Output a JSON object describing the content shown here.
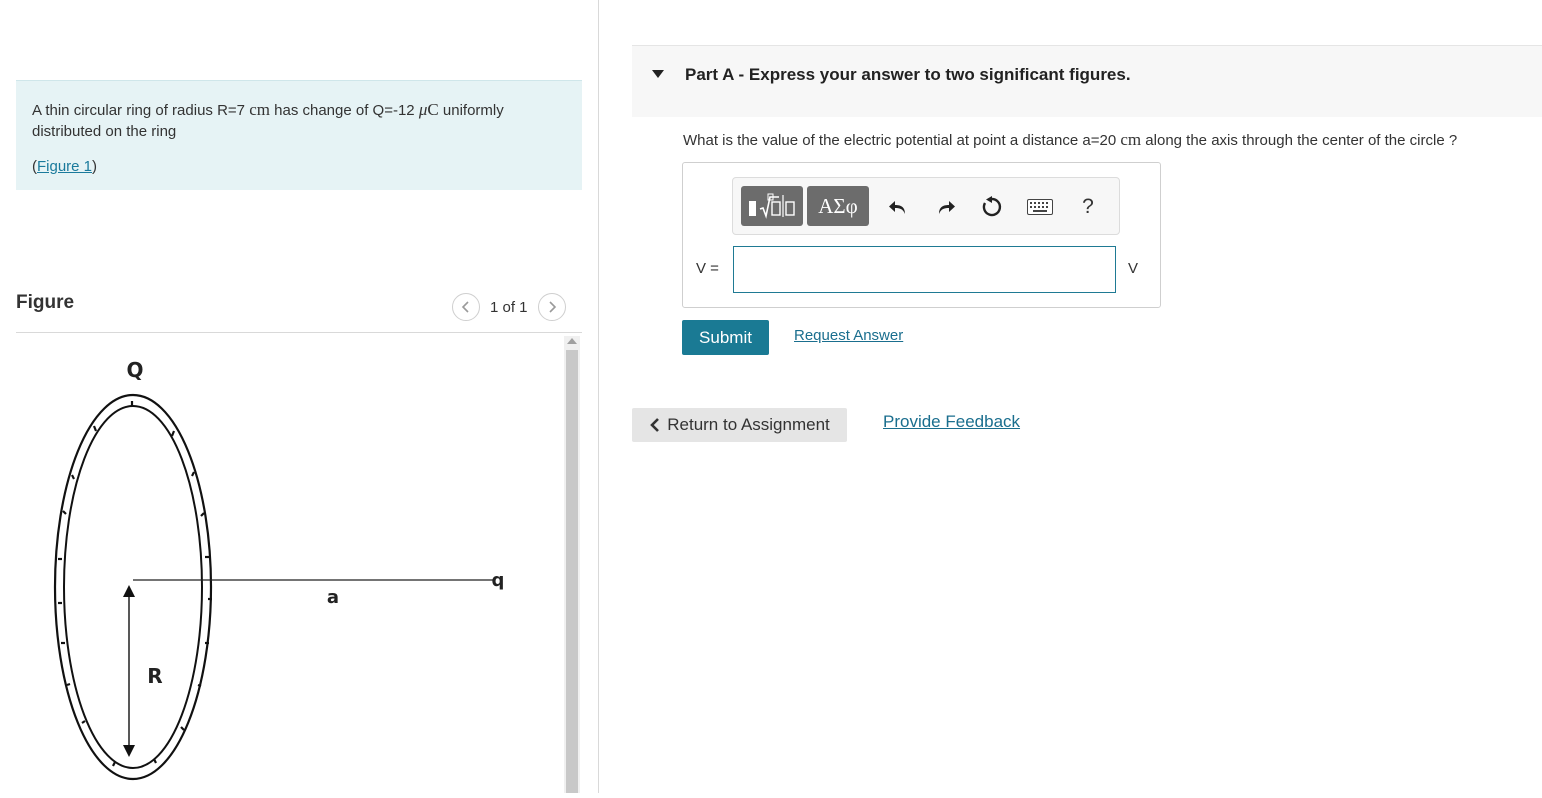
{
  "problem": {
    "text_prefix": "A thin circular ring of radius R=7 ",
    "unit_cm": "cm",
    "text_mid": " has change of Q=-12 ",
    "mu": "μ",
    "unit_c": "C",
    "text_suffix": "  uniformly distributed on the ring",
    "figure_link_open": "(",
    "figure_link": "Figure 1",
    "figure_link_close": ")"
  },
  "figure": {
    "heading": "Figure",
    "pager_text": "1 of 1",
    "prev_icon": "chevron-left-icon",
    "next_icon": "chevron-right-icon",
    "labels": {
      "charge": "Q",
      "radius": "R",
      "distance": "a",
      "point": "q"
    }
  },
  "part": {
    "title": "Part A - Express your answer to two significant figures.",
    "question_prefix": "What is the value of the electric potential at point a distance a=20 ",
    "question_unit": "cm",
    "question_suffix": " along the axis through the center of the circle ?"
  },
  "toolbar": {
    "templates_icon": "templates-radical-icon",
    "greek_label": "ΑΣφ",
    "undo_icon": "undo-icon",
    "redo_icon": "redo-icon",
    "reset_icon": "reset-icon",
    "keyboard_icon": "keyboard-icon",
    "help_label": "?"
  },
  "answer": {
    "variable_label": "V =",
    "value": "",
    "unit": "V"
  },
  "actions": {
    "submit": "Submit",
    "request_answer": "Request Answer",
    "return_label": "Return to Assignment",
    "feedback": "Provide Feedback"
  }
}
